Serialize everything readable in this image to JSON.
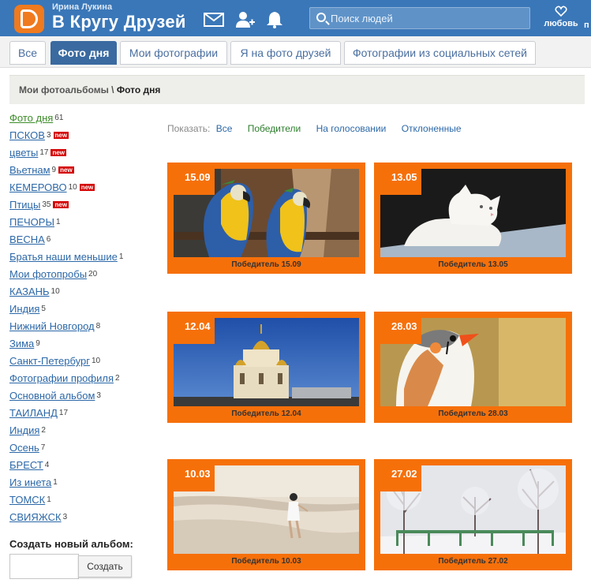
{
  "header": {
    "user_name": "Ирина Лукина",
    "brand": "В Кругу Друзей",
    "search_placeholder": "Поиск людей",
    "love_label": "любовь",
    "edge_label": "п",
    "brand_color": "#3a77b8",
    "logo_color": "#f07a1e"
  },
  "tabs": [
    {
      "label": "Все",
      "active": false
    },
    {
      "label": "Фото дня",
      "active": true
    },
    {
      "label": "Мои фотографии",
      "active": false
    },
    {
      "label": "Я на фото друзей",
      "active": false
    },
    {
      "label": "Фотографии из социальных сетей",
      "active": false
    }
  ],
  "breadcrumb": {
    "root": "Мои фотоальбомы",
    "sep": " \\ ",
    "current": "Фото дня"
  },
  "albums": [
    {
      "name": "Фото дня",
      "count": "61",
      "new": false,
      "selected": true
    },
    {
      "name": "ПСКОВ",
      "count": "3",
      "new": true
    },
    {
      "name": "цветы",
      "count": "17",
      "new": true
    },
    {
      "name": "Вьетнам",
      "count": "9",
      "new": true
    },
    {
      "name": "КЕМЕРОВО",
      "count": "10",
      "new": true
    },
    {
      "name": "Птицы",
      "count": "35",
      "new": true
    },
    {
      "name": "ПЕЧОРЫ",
      "count": "1",
      "new": false
    },
    {
      "name": "ВЕСНА",
      "count": "6",
      "new": false
    },
    {
      "name": "Братья наши меньшие",
      "count": "1",
      "new": false
    },
    {
      "name": "Мои фотопробы",
      "count": "20",
      "new": false
    },
    {
      "name": "КАЗАНЬ",
      "count": "10",
      "new": false
    },
    {
      "name": "Индия",
      "count": "5",
      "new": false
    },
    {
      "name": "Нижний Новгород",
      "count": "8",
      "new": false
    },
    {
      "name": "Зима",
      "count": "9",
      "new": false
    },
    {
      "name": "Санкт-Петербург",
      "count": "10",
      "new": false
    },
    {
      "name": "Фотографии профиля",
      "count": "2",
      "new": false
    },
    {
      "name": "Основной альбом",
      "count": "3",
      "new": false
    },
    {
      "name": "ТАИЛАНД",
      "count": "17",
      "new": false
    },
    {
      "name": "Индия",
      "count": "2",
      "new": false
    },
    {
      "name": "Осень",
      "count": "7",
      "new": false
    },
    {
      "name": "БРЕСТ",
      "count": "4",
      "new": false
    },
    {
      "name": "Из инета",
      "count": "1",
      "new": false
    },
    {
      "name": "ТОМСК",
      "count": "1",
      "new": false
    },
    {
      "name": "СВИЯЖСК",
      "count": "3",
      "new": false
    }
  ],
  "new_badge": "new",
  "new_album": {
    "label": "Создать новый альбом:",
    "button": "Создать"
  },
  "filter": {
    "label": "Показать:",
    "options": [
      "Все",
      "Победители",
      "На голосовании",
      "Отклоненные"
    ]
  },
  "photos": [
    {
      "date": "15.09",
      "caption": "Победитель 15.09",
      "subject": "parrots"
    },
    {
      "date": "13.05",
      "caption": "Победитель 13.05",
      "subject": "white-cat"
    },
    {
      "date": "12.04",
      "caption": "Победитель 12.04",
      "subject": "cathedral"
    },
    {
      "date": "28.03",
      "caption": "Победитель 28.03",
      "subject": "finch-bird"
    },
    {
      "date": "10.03",
      "caption": "Победитель 10.03",
      "subject": "child-on-beach"
    },
    {
      "date": "27.02",
      "caption": "Победитель 27.02",
      "subject": "snowy-park"
    }
  ],
  "colors": {
    "card_orange": "#f6700a",
    "link_blue": "#2c68a8",
    "link_green": "#3d8c2a",
    "badge_red": "#d40000"
  }
}
